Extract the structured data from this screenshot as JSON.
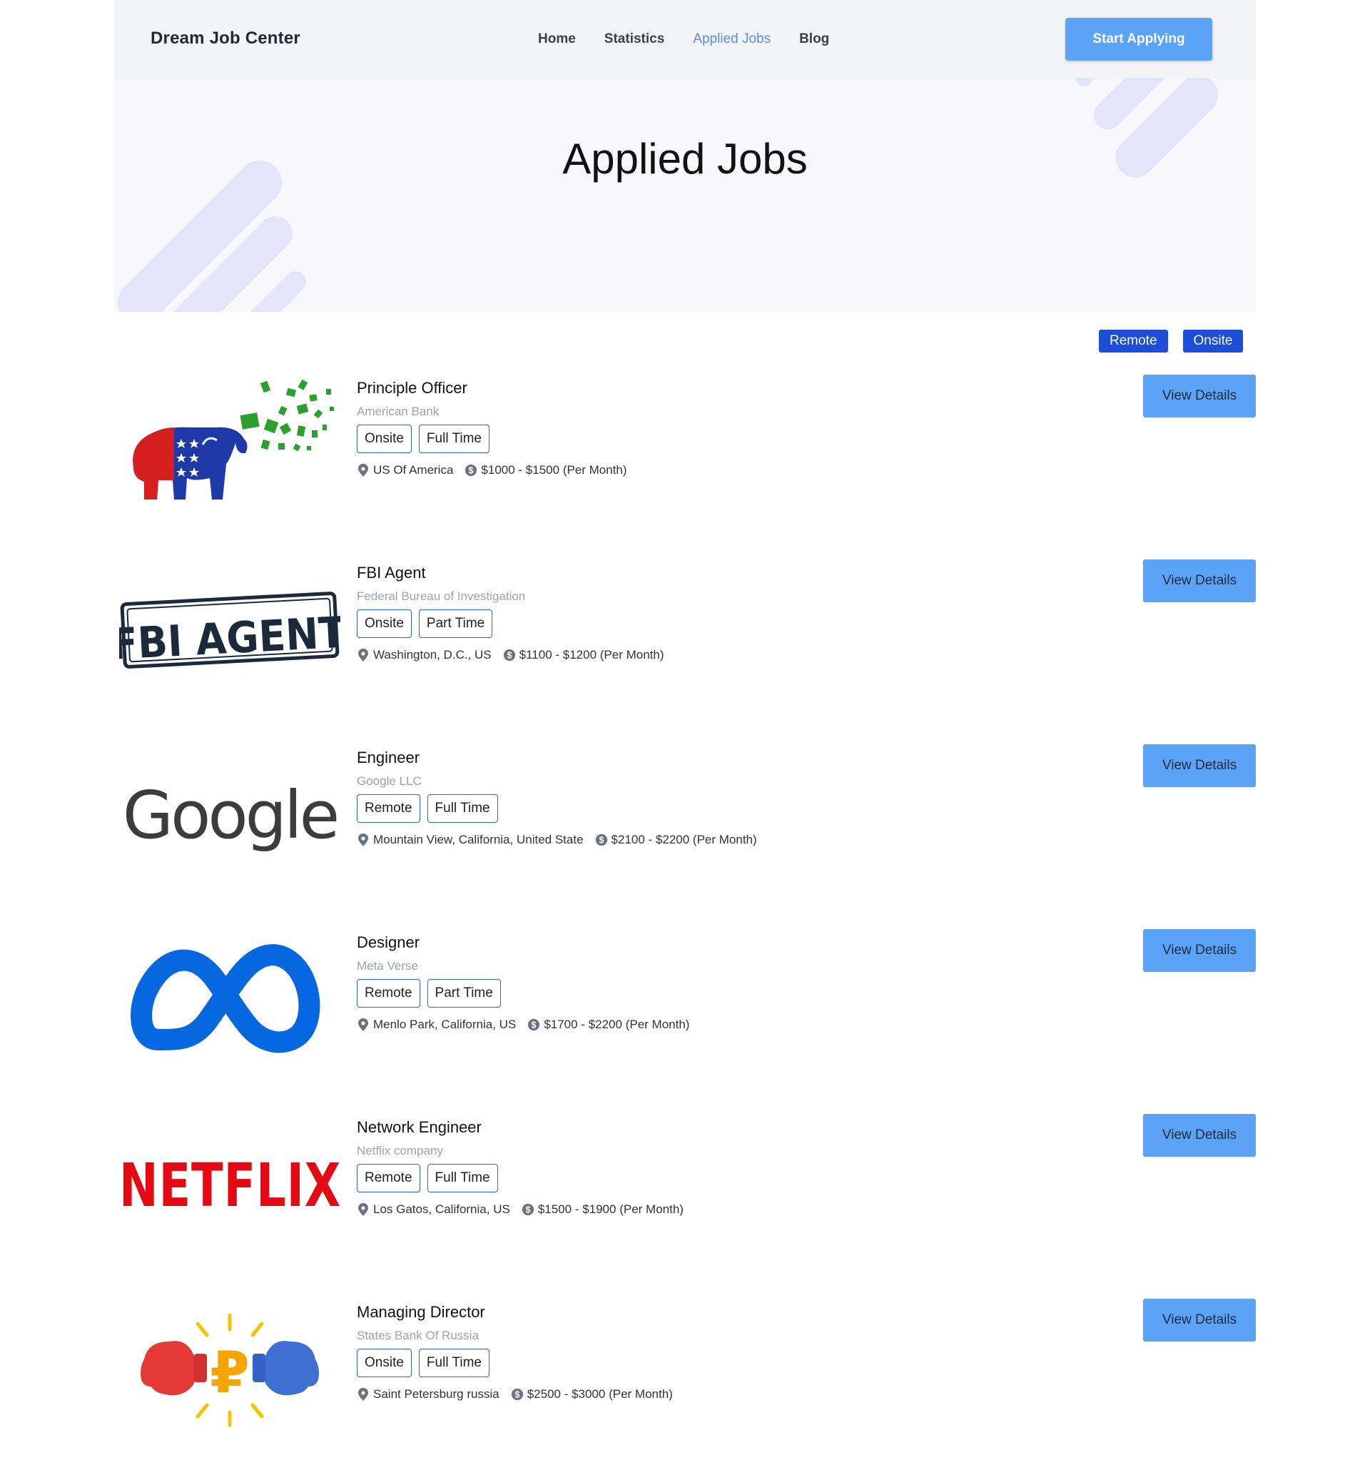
{
  "navbar": {
    "brand": "Dream Job Center",
    "links": [
      {
        "label": "Home"
      },
      {
        "label": "Statistics"
      },
      {
        "label": "Applied Jobs"
      },
      {
        "label": "Blog"
      }
    ],
    "cta_label": "Start Applying"
  },
  "banner": {
    "title": "Applied Jobs"
  },
  "filters": {
    "remote_label": "Remote",
    "onsite_label": "Onsite"
  },
  "view_details_label": "View Details",
  "jobs": [
    {
      "title": "Principle Officer",
      "company": "American Bank",
      "type": "Onsite",
      "time": "Full Time",
      "location": "US Of America",
      "salary": "$1000 - $1500 (Per Month)",
      "logo": "elephant-logo"
    },
    {
      "title": "FBI Agent",
      "company": "Federal Bureau of Investigation",
      "type": "Onsite",
      "time": "Part Time",
      "location": "Washington, D.C., US",
      "salary": "$1100 - $1200 (Per Month)",
      "logo": "fbi-agent-logo",
      "logo_text": "FBI AGENT"
    },
    {
      "title": "Engineer",
      "company": "Google LLC",
      "type": "Remote",
      "time": "Full Time",
      "location": "Mountain View, California, United State",
      "salary": "$2100 - $2200 (Per Month)",
      "logo": "google-logo",
      "logo_text": "Google"
    },
    {
      "title": "Designer",
      "company": "Meta Verse",
      "type": "Remote",
      "time": "Part Time",
      "location": "Menlo Park, California, US",
      "salary": "$1700 - $2200 (Per Month)",
      "logo": "meta-logo"
    },
    {
      "title": "Network Engineer",
      "company": "Netflix company",
      "type": "Remote",
      "time": "Full Time",
      "location": "Los Gatos, California, US",
      "salary": "$1500 - $1900 (Per Month)",
      "logo": "netflix-logo",
      "logo_text": "NETFLIX"
    },
    {
      "title": "Managing Director",
      "company": "States Bank Of Russia",
      "type": "Onsite",
      "time": "Full Time",
      "location": "Saint Petersburg russia",
      "salary": "$2500 - $3000 (Per Month)",
      "logo": "ruble-boxing-logo",
      "logo_text": "₽"
    }
  ],
  "colors": {
    "accent_blue": "#5ba3f7",
    "filter_blue": "#1d4ed8",
    "nav_active": "#5b8def",
    "netflix_red": "#e50914",
    "meta_blue": "#0668e1"
  }
}
